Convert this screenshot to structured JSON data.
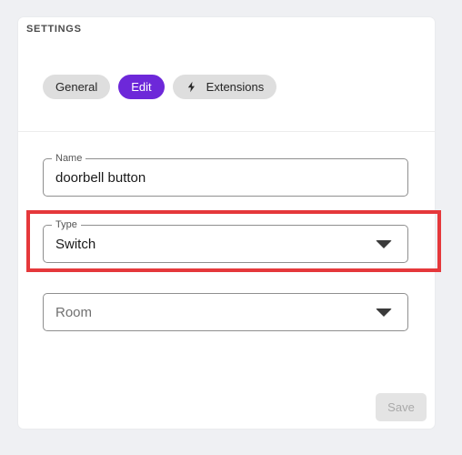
{
  "header": {
    "title": "SETTINGS"
  },
  "tabs": [
    {
      "label": "General",
      "active": false
    },
    {
      "label": "Edit",
      "active": true
    },
    {
      "label": "Extensions",
      "active": false,
      "icon": "bolt-icon"
    }
  ],
  "form": {
    "name": {
      "label": "Name",
      "value": "doorbell button"
    },
    "type": {
      "label": "Type",
      "value": "Switch"
    },
    "room": {
      "placeholder": "Room"
    }
  },
  "actions": {
    "save_label": "Save"
  },
  "colors": {
    "accent": "#6d28d9",
    "highlight": "#e5383b"
  }
}
